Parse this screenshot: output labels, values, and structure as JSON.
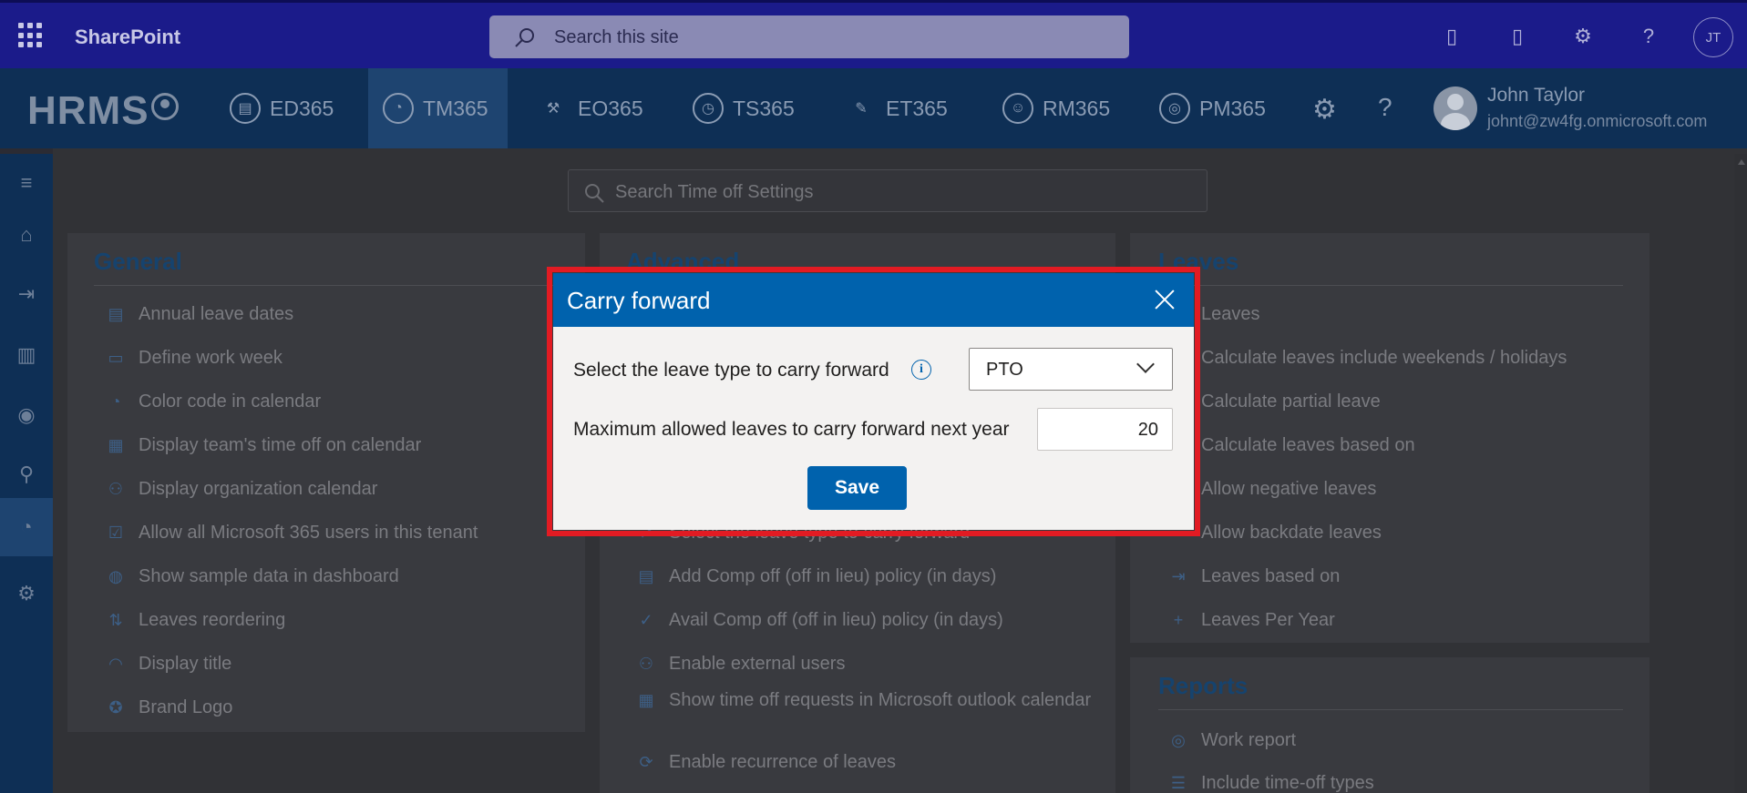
{
  "suitebar": {
    "brand": "SharePoint",
    "search_placeholder": "Search this site",
    "avatar_initials": "JT"
  },
  "appnav": {
    "logo": "HRMS",
    "items": [
      {
        "label": "ED365",
        "icon": "employee-directory-icon"
      },
      {
        "label": "TM365",
        "icon": "time-off-icon",
        "active": true
      },
      {
        "label": "EO365",
        "icon": "onboarding-icon"
      },
      {
        "label": "TS365",
        "icon": "timesheet-icon"
      },
      {
        "label": "ET365",
        "icon": "expense-icon"
      },
      {
        "label": "RM365",
        "icon": "recruitment-icon"
      },
      {
        "label": "PM365",
        "icon": "performance-icon"
      }
    ],
    "user": {
      "name": "John Taylor",
      "email": "johnt@zw4fg.onmicrosoft.com"
    }
  },
  "content": {
    "search_placeholder": "Search Time off Settings",
    "general": {
      "title": "General",
      "items": [
        "Annual leave dates",
        "Define work week",
        "Color code in calendar",
        "Display team's time off on calendar",
        "Display organization calendar",
        "Allow all Microsoft 365 users in this tenant",
        "Show sample data in dashboard",
        "Leaves reordering",
        "Display title",
        "Brand Logo"
      ]
    },
    "advanced": {
      "title": "Advanced",
      "items": [
        "Select the leave type to carry forward",
        "Add Comp off (off in lieu) policy (in days)",
        "Avail Comp off (off in lieu) policy (in days)",
        "Enable external users",
        "Show time off requests in Microsoft outlook calendar",
        "Enable recurrence of leaves"
      ]
    },
    "leaves": {
      "title": "Leaves",
      "items": [
        "Leaves",
        "Calculate leaves include weekends / holidays",
        "Calculate partial leave",
        "Calculate leaves based on",
        "Allow negative leaves",
        "Allow backdate leaves",
        "Leaves based on",
        "Leaves Per Year"
      ]
    },
    "reports": {
      "title": "Reports",
      "items": [
        "Work report",
        "Include time-off types"
      ]
    }
  },
  "dialog": {
    "title": "Carry forward",
    "leave_type_label": "Select the leave type to carry forward",
    "leave_type_value": "PTO",
    "max_label": "Maximum allowed leaves to carry forward next year",
    "max_value": "20",
    "save_label": "Save",
    "info_glyph": "i"
  },
  "colors": {
    "suitebar": "#1b1b8a",
    "appnav": "#0e2f55",
    "dialog_header": "#0062ad",
    "highlight": "#e21b23"
  }
}
